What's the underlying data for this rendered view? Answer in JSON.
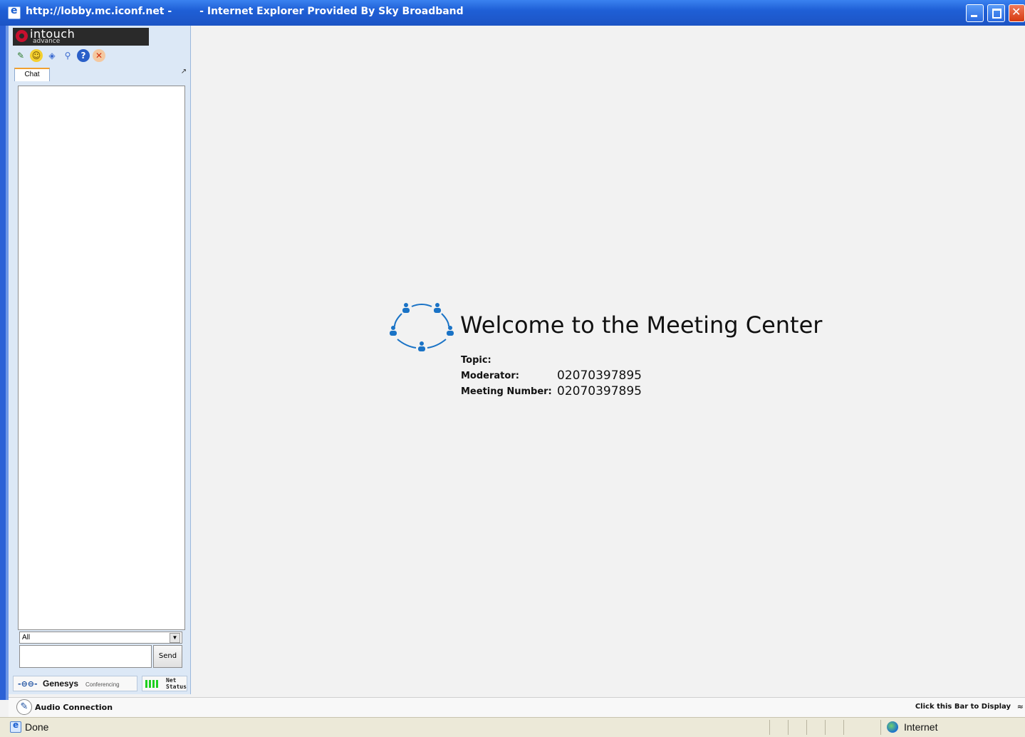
{
  "window": {
    "title": "http://lobby.mc.iconf.net -        - Internet Explorer Provided By Sky Broadband"
  },
  "sidebar": {
    "logo": {
      "line1": "intouch",
      "line2": "advance"
    },
    "toolbar_icons": [
      "tools-icon",
      "smiley-icon",
      "stamp-icon",
      "magnifier-icon",
      "help-icon",
      "exit-icon"
    ],
    "tab_label": "Chat",
    "recipient": "All",
    "message_value": "",
    "send_label": "Send",
    "brand_name": "Genesys",
    "brand_sub": "Conferencing",
    "net_status_label": "Net Status"
  },
  "main": {
    "welcome_title": "Welcome to the Meeting Center",
    "topic_label": "Topic:",
    "topic_value": "",
    "moderator_label": "Moderator:",
    "moderator_value": "02070397895",
    "meeting_number_label": "Meeting Number:",
    "meeting_number_value": "02070397895",
    "accent_color": "#1a73c6"
  },
  "audio_bar": {
    "label": "Audio Connection",
    "display_hint": "Click this Bar to Display"
  },
  "statusbar": {
    "status": "Done",
    "zone": "Internet"
  }
}
